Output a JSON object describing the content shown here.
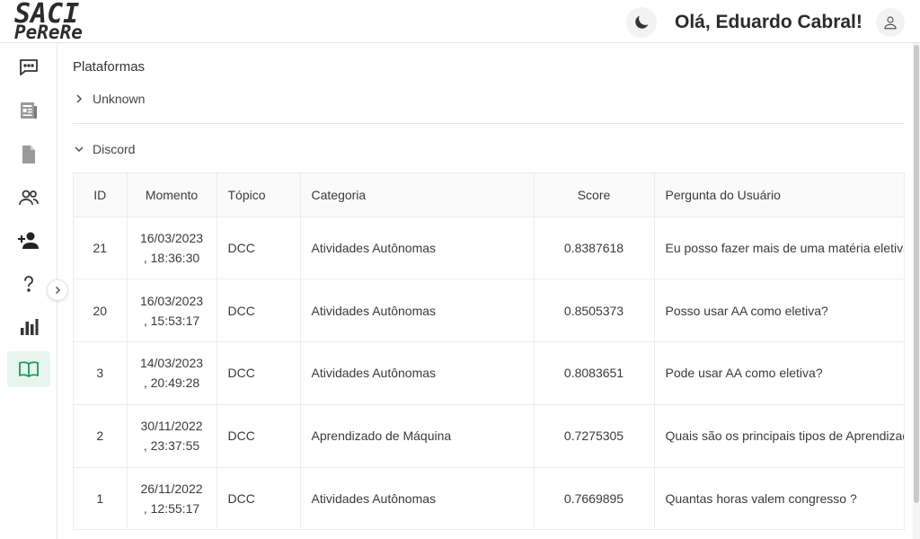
{
  "header": {
    "logo_line1": "SACI",
    "logo_line2": "PeReRe",
    "greeting": "Olá, Eduardo Cabral!",
    "theme_icon": "moon-icon",
    "user_icon": "user-icon"
  },
  "sidebar": {
    "items": [
      {
        "name": "chat-icon",
        "active": false
      },
      {
        "name": "newspaper-icon",
        "active": false
      },
      {
        "name": "document-icon",
        "active": false
      },
      {
        "name": "users-icon",
        "active": false
      },
      {
        "name": "add-user-icon",
        "active": false
      },
      {
        "name": "help-icon",
        "active": false
      },
      {
        "name": "bar-chart-icon",
        "active": false
      },
      {
        "name": "book-icon",
        "active": true
      }
    ],
    "active_color": "#1a9a5a"
  },
  "main": {
    "title": "Plataformas",
    "panels": [
      {
        "label": "Unknown",
        "expanded": false
      },
      {
        "label": "Discord",
        "expanded": true
      }
    ],
    "table": {
      "columns": [
        "ID",
        "Momento",
        "Tópico",
        "Categoria",
        "Score",
        "Pergunta do Usuário"
      ],
      "rows": [
        {
          "id": "21",
          "date": "16/03/2023",
          "time": ", 18:36:30",
          "topic": "DCC",
          "category": "Atividades Autônomas",
          "score": "0.8387618",
          "question": "Eu posso fazer mais de uma matéria eletiva"
        },
        {
          "id": "20",
          "date": "16/03/2023",
          "time": ", 15:53:17",
          "topic": "DCC",
          "category": "Atividades Autônomas",
          "score": "0.8505373",
          "question": "Posso usar AA como eletiva?"
        },
        {
          "id": "3",
          "date": "14/03/2023",
          "time": ", 20:49:28",
          "topic": "DCC",
          "category": "Atividades Autônomas",
          "score": "0.8083651",
          "question": "Pode usar AA como eletiva?"
        },
        {
          "id": "2",
          "date": "30/11/2022",
          "time": ", 23:37:55",
          "topic": "DCC",
          "category": "Aprendizado de Máquina",
          "score": "0.7275305",
          "question": "Quais são os principais tipos de Aprendizado"
        },
        {
          "id": "1",
          "date": "26/11/2022",
          "time": ", 12:55:17",
          "topic": "DCC",
          "category": "Atividades Autônomas",
          "score": "0.7669895",
          "question": "Quantas horas valem congresso ?"
        }
      ]
    }
  }
}
